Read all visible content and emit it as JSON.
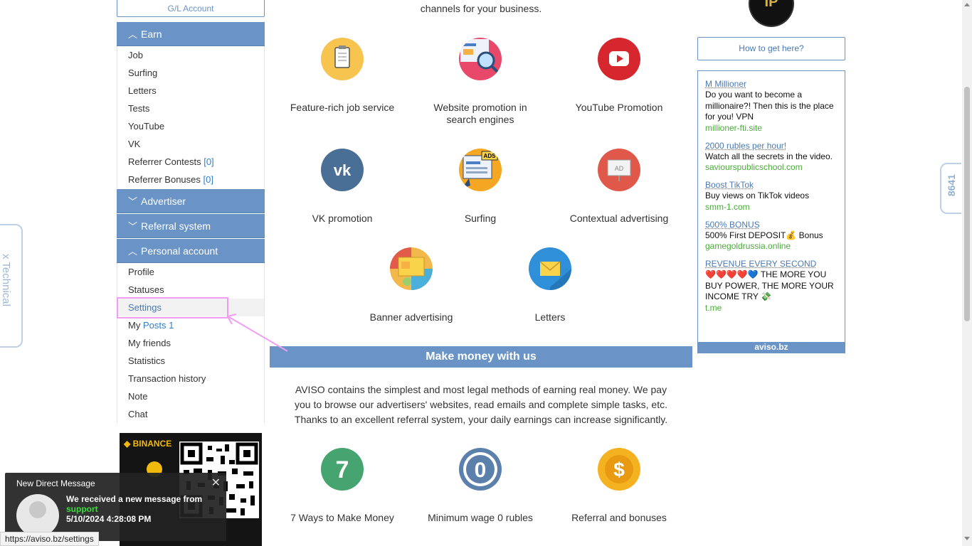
{
  "sidebar": {
    "gl_account": "G/L Account",
    "sections": {
      "earn": "Earn",
      "advertiser": "Advertiser",
      "referral": "Referral system",
      "personal": "Personal account"
    },
    "earn_items": [
      "Job",
      "Surfing",
      "Letters",
      "Tests",
      "YouTube",
      "VK"
    ],
    "referrer_contests": "Referrer Contests",
    "referrer_contests_count": "[0]",
    "referrer_bonuses": "Referrer Bonuses",
    "referrer_bonuses_count": "[0]",
    "personal_items": {
      "profile": "Profile",
      "statuses": "Statuses",
      "settings": "Settings",
      "my_posts_prefix": "My",
      "my_posts_link": "Posts 1",
      "my_friends": "My friends",
      "statistics": "Statistics",
      "transaction_history": "Transaction history",
      "note": "Note",
      "chat": "Chat"
    },
    "banner_logo": "BINANCE"
  },
  "center": {
    "intro": "channels for your business.",
    "services": [
      {
        "label": "Feature-rich job service",
        "icon": "clipboard-icon",
        "color": "#f6c44f"
      },
      {
        "label": "Website promotion in search engines",
        "icon": "seo-magnifier-icon",
        "color": "#e8496b"
      },
      {
        "label": "YouTube Promotion",
        "icon": "youtube-icon",
        "color": "#d6262e"
      },
      {
        "label": "VK promotion",
        "icon": "vk-icon",
        "color": "#4a6f96"
      },
      {
        "label": "Surfing",
        "icon": "ads-browser-icon",
        "color": "#f5a623"
      },
      {
        "label": "Contextual advertising",
        "icon": "ad-board-icon",
        "color": "#e0584a"
      },
      {
        "label": "Banner advertising",
        "icon": "banner-icon",
        "color": "#f2b84b"
      },
      {
        "label": "Letters",
        "icon": "envelope-icon",
        "color": "#2f8fd9"
      }
    ],
    "make_money_title": "Make money with us",
    "aviso_text": "AVISO contains the simplest and most legal methods of earning real money. We pay you to browse our advertisers' websites, read emails and complete simple tasks, etc. Thanks to an excellent referral system, your daily earnings can increase significantly.",
    "features": [
      {
        "label": "7 Ways to Make Money",
        "glyph": "7",
        "color": "#45a46f"
      },
      {
        "label": "Minimum wage 0 rubles",
        "glyph": "0",
        "color": "#5b80ab"
      },
      {
        "label": "Referral and bonuses",
        "glyph": "$",
        "color": "#f4b221"
      }
    ]
  },
  "right": {
    "logo_text": "IP",
    "how_button": "How to get here?",
    "ads": [
      {
        "title": "M Millioner",
        "desc": "Do you want to become a millionaire?! Then this is the place for you! VPN",
        "url": "millioner-fti.site"
      },
      {
        "title": "2000 rubles per hour!",
        "desc": "Watch all the secrets in the video.",
        "url": "saviourspublicschool.com"
      },
      {
        "title": "Boost TikTok",
        "desc": "Buy views on TikTok videos",
        "url": "smm-1.com"
      },
      {
        "title": "500% BONUS",
        "desc": "500% First DEPOSIT💰 Bonus",
        "url": "gamegoldrussia.online"
      },
      {
        "title": "REVENUE EVERY SECOND",
        "desc": "❤️❤️❤️❤️💙 THE MORE YOU BUY POWER, THE MORE YOUR INCOME TRY 💸",
        "url": "t.me"
      }
    ],
    "footer": "aviso.bz"
  },
  "tabs": {
    "technical": "x Technical",
    "counter": "8641"
  },
  "notification": {
    "title": "New Direct Message",
    "line1": "We received a new message from",
    "sender": "support",
    "timestamp": "5/10/2024 4:28:08 PM",
    "close": "✕"
  },
  "status_url": "https://aviso.bz/settings"
}
